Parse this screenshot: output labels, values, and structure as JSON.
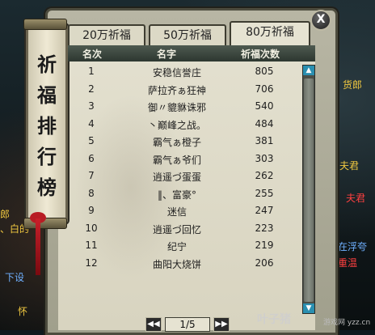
{
  "banner": {
    "title": "祈福排行榜"
  },
  "tabs": [
    {
      "label": "20万祈福",
      "active": false
    },
    {
      "label": "50万祈福",
      "active": false
    },
    {
      "label": "80万祈福",
      "active": true
    }
  ],
  "close_label": "X",
  "table": {
    "columns": [
      "名次",
      "名字",
      "祈福次数"
    ],
    "rows": [
      {
        "rank": "1",
        "name": "安稳信誉庄",
        "count": "805"
      },
      {
        "rank": "2",
        "name": "萨拉齐ぁ狂神",
        "count": "706"
      },
      {
        "rank": "3",
        "name": "御〃貔貅诛邪",
        "count": "540"
      },
      {
        "rank": "4",
        "name": "丶巅峰之战。",
        "count": "484"
      },
      {
        "rank": "5",
        "name": "霸气ぁ橙子",
        "count": "381"
      },
      {
        "rank": "6",
        "name": "霸气ぁ爷们",
        "count": "303"
      },
      {
        "rank": "7",
        "name": "逍遥づ蛋蛋",
        "count": "262"
      },
      {
        "rank": "8",
        "name": "‖、富豪°",
        "count": "255"
      },
      {
        "rank": "9",
        "name": "迷信",
        "count": "247"
      },
      {
        "rank": "10",
        "name": "逍遥づ回忆",
        "count": "223"
      },
      {
        "rank": "11",
        "name": "纪宁",
        "count": "219"
      },
      {
        "rank": "12",
        "name": "曲阳大烧饼",
        "count": "206"
      }
    ]
  },
  "pager": {
    "prev": "◀◀",
    "page": "1/5",
    "next": "▶▶"
  },
  "scene": {
    "left_texts": [
      "郎",
      "、白的",
      "下设",
      "怀"
    ],
    "right_texts": [
      "货郎",
      "夫君",
      "夫君",
      "在浮夸",
      "重温"
    ]
  },
  "watermark": {
    "main": "叶子猪",
    "sub": "游戏网 yzz.cn"
  },
  "colors": {
    "header_bg": "#3a453c",
    "scroll_arrow": "#2a8fb0",
    "tassel": "#c8202a"
  }
}
